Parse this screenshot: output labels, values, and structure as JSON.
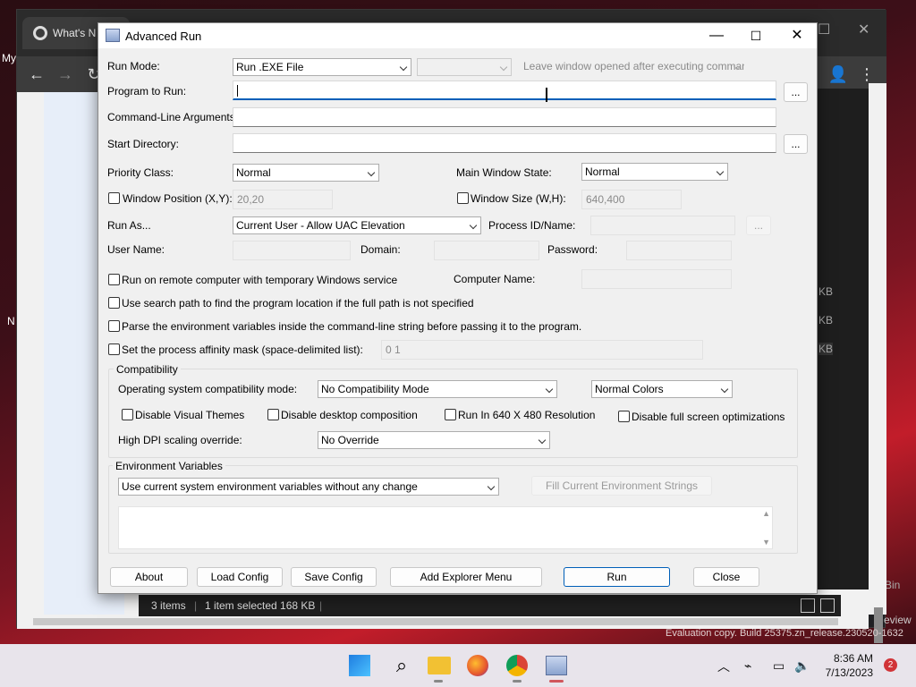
{
  "browser": {
    "tab_title": "What's N",
    "side_label": "My"
  },
  "explorer": {
    "items": "3 items",
    "selected": "1 item selected  168 KB",
    "sizes": [
      "KB",
      "KB",
      "KB"
    ],
    "bin_label": "Bin",
    "preview_label": "eview"
  },
  "desktop": {
    "watermark": "Evaluation copy. Build 25375.zn_release.230520-1632"
  },
  "dialog": {
    "title": "Advanced Run",
    "run_mode_label": "Run Mode:",
    "run_mode_value": "Run .EXE File",
    "leave_window_value": "Leave window opened after executing command",
    "program_label": "Program to Run:",
    "program_value": "",
    "cmdline_label": "Command-Line Arguments:",
    "startdir_label": "Start Directory:",
    "browse_label": "...",
    "priority_label": "Priority Class:",
    "priority_value": "Normal",
    "mainwin_label": "Main Window State:",
    "mainwin_value": "Normal",
    "winpos_label": "Window Position (X,Y):",
    "winpos_value": "20,20",
    "winsize_label": "Window Size (W,H):",
    "winsize_value": "640,400",
    "runas_label": "Run As...",
    "runas_value": "Current User - Allow UAC Elevation",
    "pid_label": "Process ID/Name:",
    "username_label": "User Name:",
    "domain_label": "Domain:",
    "password_label": "Password:",
    "remote_label": "Run on remote computer with temporary Windows service",
    "computer_label": "Computer Name:",
    "searchpath_label": "Use search path to find the program location if the full path is not specified",
    "parseenv_label": "Parse the environment variables inside the command-line string before passing it to the program.",
    "affinity_label": "Set the process affinity mask (space-delimited list):",
    "affinity_value": "0 1",
    "compat_group": "Compatibility",
    "oscompat_label": "Operating system compatibility mode:",
    "oscompat_value": "No Compatibility Mode",
    "colors_value": "Normal Colors",
    "visual_themes_label": "Disable Visual Themes",
    "desktop_comp_label": "Disable desktop composition",
    "res640_label": "Run In 640 X 480 Resolution",
    "fullscreen_label": "Disable full screen optimizations",
    "dpi_label": "High DPI scaling override:",
    "dpi_value": "No Override",
    "env_group": "Environment Variables",
    "env_value": "Use current system environment variables without any change",
    "fill_env_label": "Fill Current Environment Strings",
    "buttons": {
      "about": "About",
      "load": "Load Config",
      "save": "Save Config",
      "explorer_menu": "Add Explorer Menu",
      "run": "Run",
      "close": "Close"
    }
  },
  "taskbar": {
    "time": "8:36 AM",
    "date": "7/13/2023",
    "badge": "2"
  },
  "colors": {
    "accent": "#005fb8",
    "badge": "#d13438"
  }
}
